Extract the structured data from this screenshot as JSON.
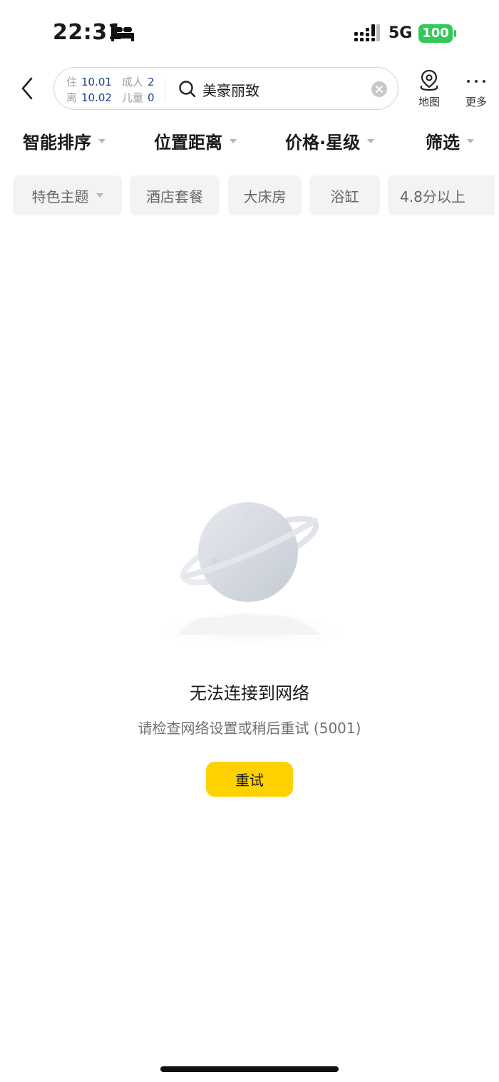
{
  "status_bar": {
    "time": "22:31",
    "network": "5G",
    "battery": "100",
    "battery_color": "#34c759"
  },
  "header": {
    "checkin_label": "住",
    "checkin_date": "10.01",
    "checkout_label": "离",
    "checkout_date": "10.02",
    "adults_label": "成人",
    "adults_count": "2",
    "children_label": "儿童",
    "children_count": "0",
    "search_keyword": "美豪丽致",
    "map_label": "地图",
    "more_label": "更多"
  },
  "sort_bar": {
    "items": [
      {
        "label": "智能排序"
      },
      {
        "label": "位置距离"
      },
      {
        "label": "价格·星级"
      },
      {
        "label": "筛选"
      }
    ]
  },
  "chips": [
    {
      "label": "特色主题"
    },
    {
      "label": "酒店套餐"
    },
    {
      "label": "大床房"
    },
    {
      "label": "浴缸"
    },
    {
      "label": "4.8分以上"
    }
  ],
  "empty_state": {
    "title": "无法连接到网络",
    "description": "请检查网络设置或稍后重试 (5001)",
    "retry_label": "重试",
    "retry_color": "#ffd100"
  },
  "icons": [
    "bed-icon",
    "signal-icon",
    "back-icon",
    "search-icon",
    "clear-icon",
    "map-pin-icon",
    "more-icon",
    "planet-illustration"
  ]
}
